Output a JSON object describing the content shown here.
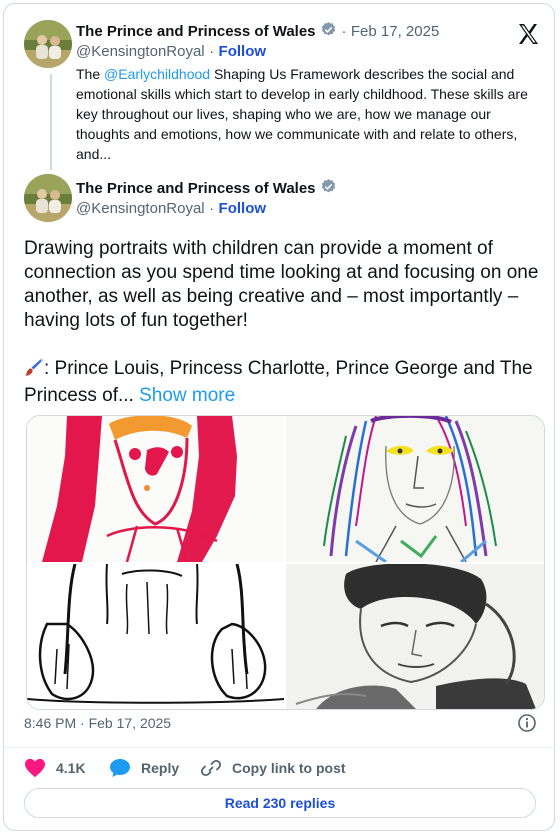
{
  "quoted_tweet": {
    "display_name": "The Prince and Princess of Wales",
    "separator": "·",
    "date": "Feb 17, 2025",
    "handle": "@KensingtonRoyal",
    "follow_sep": "·",
    "follow_label": "Follow",
    "text_pre": "The ",
    "mention": "@Earlychildhood",
    "text_post": " Shaping Us Framework describes the social and emotional skills which start to develop in early childhood. These skills are key throughout our lives, shaping who we are, how we manage our thoughts and emotions, how we communicate with and relate to others, and..."
  },
  "main_tweet": {
    "display_name": "The Prince and Princess of Wales",
    "handle": "@KensingtonRoyal",
    "follow_sep": "·",
    "follow_label": "Follow",
    "paragraph_1": "Drawing portraits with children can provide a moment of connection as you spend time looking at and focusing on one another, as well as being creative and – most importantly – having lots of fun together!",
    "paragraph_2": ": Prince Louis, Princess Charlotte, Prince George and The Princess of...",
    "show_more": "Show more",
    "timestamp": "8:46 PM · Feb 17, 2025"
  },
  "actions": {
    "like_count": "4.1K",
    "reply_label": "Reply",
    "copy_label": "Copy link to post"
  },
  "read_replies": "Read 230 replies",
  "colors": {
    "heart": "#f91880",
    "reply_bubble": "#1d9bf0",
    "link_blue": "#1d9bf0",
    "follow_blue": "#1d4ed8",
    "verified_gray": "#829aab"
  },
  "icons": {
    "logo": "x-logo-icon",
    "verified": "verified-badge-icon",
    "info": "info-icon",
    "like": "heart-icon",
    "reply": "reply-bubble-icon",
    "copy": "link-icon",
    "paint": "paintbrush-emoji-icon"
  }
}
